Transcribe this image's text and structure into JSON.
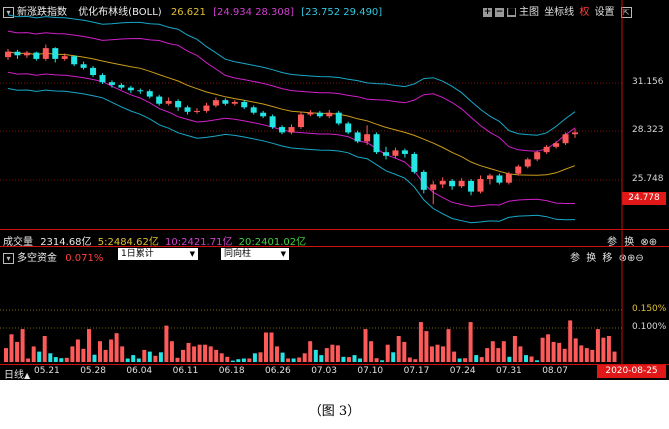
{
  "colors": {
    "up": "#ff5a5a",
    "down": "#24e4e4",
    "upper": "#18a8c8",
    "mid": "#cc9c1c",
    "lower": "#d020c8",
    "ma": "#d020c8"
  },
  "main": {
    "title": "新涨跌指数",
    "indicator": "优化布林线(BOLL)",
    "mid_value": "26.621",
    "upper_values": "[24.934 28.308]",
    "lower_values": "[23.752 29.490]",
    "buttons": {
      "zoom_in": "+",
      "zoom_out": "−",
      "main_label": "主图",
      "coord_label": "坐标线",
      "right_label": "权",
      "settings_label": "设置"
    },
    "y_ticks": [
      "31.156",
      "28.323",
      "25.748"
    ],
    "price_tag": "24.778"
  },
  "volume": {
    "label": "成交量",
    "total": "2314.68亿",
    "ma5": "5:2484.62亿",
    "ma10": "10:2421.71亿",
    "ma20": "20:2401.02亿",
    "btn_params": "参",
    "btn_switch": "换"
  },
  "flow": {
    "label": "多空资金",
    "pct": "0.071%",
    "period_select": "1日累计",
    "mode_select": "同向柱",
    "btn_params": "参",
    "btn_switch": "换",
    "btn_move": "移",
    "y_ticks": [
      "0.150%",
      "0.100%"
    ]
  },
  "axis": {
    "period": "日线",
    "dates": [
      "05.21",
      "05.28",
      "06.04",
      "06.11",
      "06.18",
      "06.26",
      "07.03",
      "07.10",
      "07.17",
      "07.24",
      "07.31",
      "08.07"
    ],
    "current_date": "2020-08-25"
  },
  "caption": "（图 3）",
  "chart_data": [
    {
      "type": "candlestick",
      "title": "新涨跌指数 优化布林线(BOLL)",
      "x": [
        "05.21",
        "05.28",
        "06.04",
        "06.11",
        "06.18",
        "06.26",
        "07.03",
        "07.10",
        "07.17",
        "07.24",
        "07.31",
        "08.07"
      ],
      "ylim": [
        23.5,
        33.5
      ],
      "y_ticks": [
        31.156,
        28.323,
        25.748
      ],
      "last_price": 24.778,
      "series": [
        {
          "name": "mid",
          "value": 26.621
        },
        {
          "name": "upper",
          "values": [
            24.934,
            28.308
          ]
        },
        {
          "name": "lower",
          "values": [
            23.752,
            29.49
          ]
        }
      ],
      "candles": [
        [
          32.6,
          32.9,
          33.05,
          32.45
        ],
        [
          32.9,
          32.7,
          33.0,
          32.5
        ],
        [
          32.7,
          32.85,
          32.95,
          32.55
        ],
        [
          32.85,
          32.5,
          32.9,
          32.4
        ],
        [
          32.5,
          33.1,
          33.3,
          32.4
        ],
        [
          33.1,
          32.5,
          33.15,
          32.3
        ],
        [
          32.5,
          32.65,
          32.8,
          32.4
        ],
        [
          32.65,
          32.2,
          32.7,
          32.1
        ],
        [
          32.2,
          32.0,
          32.35,
          31.9
        ],
        [
          32.0,
          31.6,
          32.1,
          31.5
        ],
        [
          31.6,
          31.2,
          31.7,
          31.1
        ],
        [
          31.2,
          31.05,
          31.3,
          30.9
        ],
        [
          31.05,
          30.9,
          31.15,
          30.8
        ],
        [
          30.9,
          30.75,
          31.0,
          30.6
        ],
        [
          30.75,
          30.7,
          30.85,
          30.55
        ],
        [
          30.7,
          30.4,
          30.8,
          30.3
        ],
        [
          30.4,
          30.0,
          30.5,
          29.9
        ],
        [
          30.0,
          30.15,
          30.35,
          29.9
        ],
        [
          30.15,
          29.8,
          30.25,
          29.6
        ],
        [
          29.8,
          29.55,
          29.9,
          29.4
        ],
        [
          29.55,
          29.6,
          29.75,
          29.45
        ],
        [
          29.6,
          29.9,
          30.05,
          29.5
        ],
        [
          29.9,
          30.2,
          30.35,
          29.8
        ],
        [
          30.2,
          30.0,
          30.3,
          29.9
        ],
        [
          30.0,
          30.1,
          30.2,
          29.9
        ],
        [
          30.1,
          29.8,
          30.2,
          29.7
        ],
        [
          29.8,
          29.5,
          29.9,
          29.4
        ],
        [
          29.5,
          29.3,
          29.6,
          29.2
        ],
        [
          29.3,
          28.7,
          29.4,
          28.6
        ],
        [
          28.7,
          28.4,
          28.8,
          28.3
        ],
        [
          28.4,
          28.7,
          28.85,
          28.3
        ],
        [
          28.7,
          29.4,
          29.55,
          28.6
        ],
        [
          29.4,
          29.5,
          29.65,
          29.3
        ],
        [
          29.5,
          29.3,
          29.6,
          29.2
        ],
        [
          29.3,
          29.5,
          29.65,
          29.2
        ],
        [
          29.5,
          28.9,
          29.6,
          28.8
        ],
        [
          28.9,
          28.4,
          29.0,
          28.3
        ],
        [
          28.4,
          27.9,
          28.5,
          27.8
        ],
        [
          27.9,
          28.3,
          28.8,
          27.7
        ],
        [
          28.3,
          27.3,
          28.4,
          27.2
        ],
        [
          27.3,
          27.1,
          27.6,
          26.9
        ],
        [
          27.1,
          27.4,
          27.55,
          26.95
        ],
        [
          27.4,
          27.2,
          27.5,
          27.0
        ],
        [
          27.2,
          26.2,
          27.3,
          26.1
        ],
        [
          26.2,
          25.2,
          26.3,
          25.0
        ],
        [
          25.2,
          25.5,
          25.7,
          24.4
        ],
        [
          25.5,
          25.7,
          25.9,
          25.3
        ],
        [
          25.7,
          25.4,
          25.8,
          25.2
        ],
        [
          25.4,
          25.7,
          25.85,
          25.3
        ],
        [
          25.7,
          25.1,
          25.8,
          24.9
        ],
        [
          25.1,
          25.8,
          26.0,
          25.0
        ],
        [
          25.8,
          26.0,
          26.1,
          25.5
        ],
        [
          26.0,
          25.6,
          26.1,
          25.5
        ],
        [
          25.6,
          26.1,
          26.2,
          25.5
        ],
        [
          26.1,
          26.5,
          26.6,
          26.0
        ],
        [
          26.5,
          26.9,
          27.0,
          26.4
        ],
        [
          26.9,
          27.3,
          27.4,
          26.8
        ],
        [
          27.3,
          27.6,
          27.7,
          27.2
        ],
        [
          27.6,
          27.8,
          27.9,
          27.5
        ],
        [
          27.8,
          28.3,
          28.4,
          27.7
        ],
        [
          28.3,
          28.4,
          28.6,
          28.1
        ]
      ]
    },
    {
      "type": "bar",
      "title": "多空资金",
      "x": [
        "05.21",
        "05.28",
        "06.04",
        "06.11",
        "06.18",
        "06.26",
        "07.03",
        "07.10",
        "07.17",
        "07.24",
        "07.31",
        "08.07"
      ],
      "ylim": [
        0,
        0.2
      ],
      "y_ticks": [
        0.15,
        0.1
      ],
      "values": [
        0.04,
        0.08,
        0.058,
        0.095,
        0.01,
        0.045,
        0.03,
        0.075,
        0.025,
        0.014,
        0.011,
        0.012,
        0.045,
        0.065,
        0.038,
        0.095,
        0.021,
        0.06,
        0.035,
        0.065,
        0.083,
        0.045,
        0.01,
        0.02,
        0.01,
        0.035,
        0.03,
        0.018,
        0.028,
        0.105,
        0.06,
        0.012,
        0.035,
        0.055,
        0.045,
        0.05,
        0.05,
        0.045,
        0.035,
        0.025,
        0.015,
        0.004,
        0.008,
        0.01,
        0.01,
        0.025,
        0.028,
        0.085,
        0.085,
        0.045,
        0.027,
        0.01,
        0.01,
        0.013,
        0.025,
        0.06,
        0.035,
        0.02,
        0.04,
        0.05,
        0.048,
        0.015,
        0.014,
        0.02,
        0.01,
        0.095,
        0.06,
        0.011,
        0.005,
        0.05,
        0.028,
        0.075,
        0.058,
        0.013,
        0.008,
        0.115,
        0.089,
        0.045,
        0.05,
        0.045,
        0.095,
        0.03,
        0.01,
        0.011,
        0.115,
        0.02,
        0.014,
        0.04,
        0.06,
        0.04,
        0.06,
        0.015,
        0.075,
        0.045,
        0.02,
        0.016,
        0.005,
        0.07,
        0.08,
        0.058,
        0.055,
        0.038,
        0.12,
        0.068,
        0.048,
        0.04,
        0.035,
        0.095,
        0.07,
        0.075,
        0.03
      ],
      "signs": [
        1,
        1,
        1,
        1,
        1,
        1,
        -1,
        1,
        -1,
        -1,
        -1,
        1,
        1,
        1,
        1,
        1,
        -1,
        1,
        1,
        1,
        1,
        1,
        -1,
        -1,
        -1,
        1,
        -1,
        1,
        -1,
        1,
        1,
        1,
        1,
        1,
        1,
        1,
        1,
        1,
        1,
        1,
        1,
        -1,
        -1,
        -1,
        1,
        -1,
        1,
        1,
        1,
        1,
        -1,
        1,
        -1,
        1,
        1,
        1,
        -1,
        -1,
        1,
        1,
        1,
        -1,
        1,
        -1,
        -1,
        1,
        1,
        1,
        -1,
        1,
        -1,
        1,
        1,
        1,
        1,
        1,
        1,
        1,
        1,
        1,
        1,
        1,
        -1,
        1,
        1,
        -1,
        1,
        1,
        1,
        1,
        1,
        -1,
        1,
        1,
        -1,
        1,
        -1,
        1,
        1,
        1,
        1,
        1,
        1,
        1,
        1,
        1,
        1,
        1,
        1,
        1,
        1
      ]
    }
  ]
}
